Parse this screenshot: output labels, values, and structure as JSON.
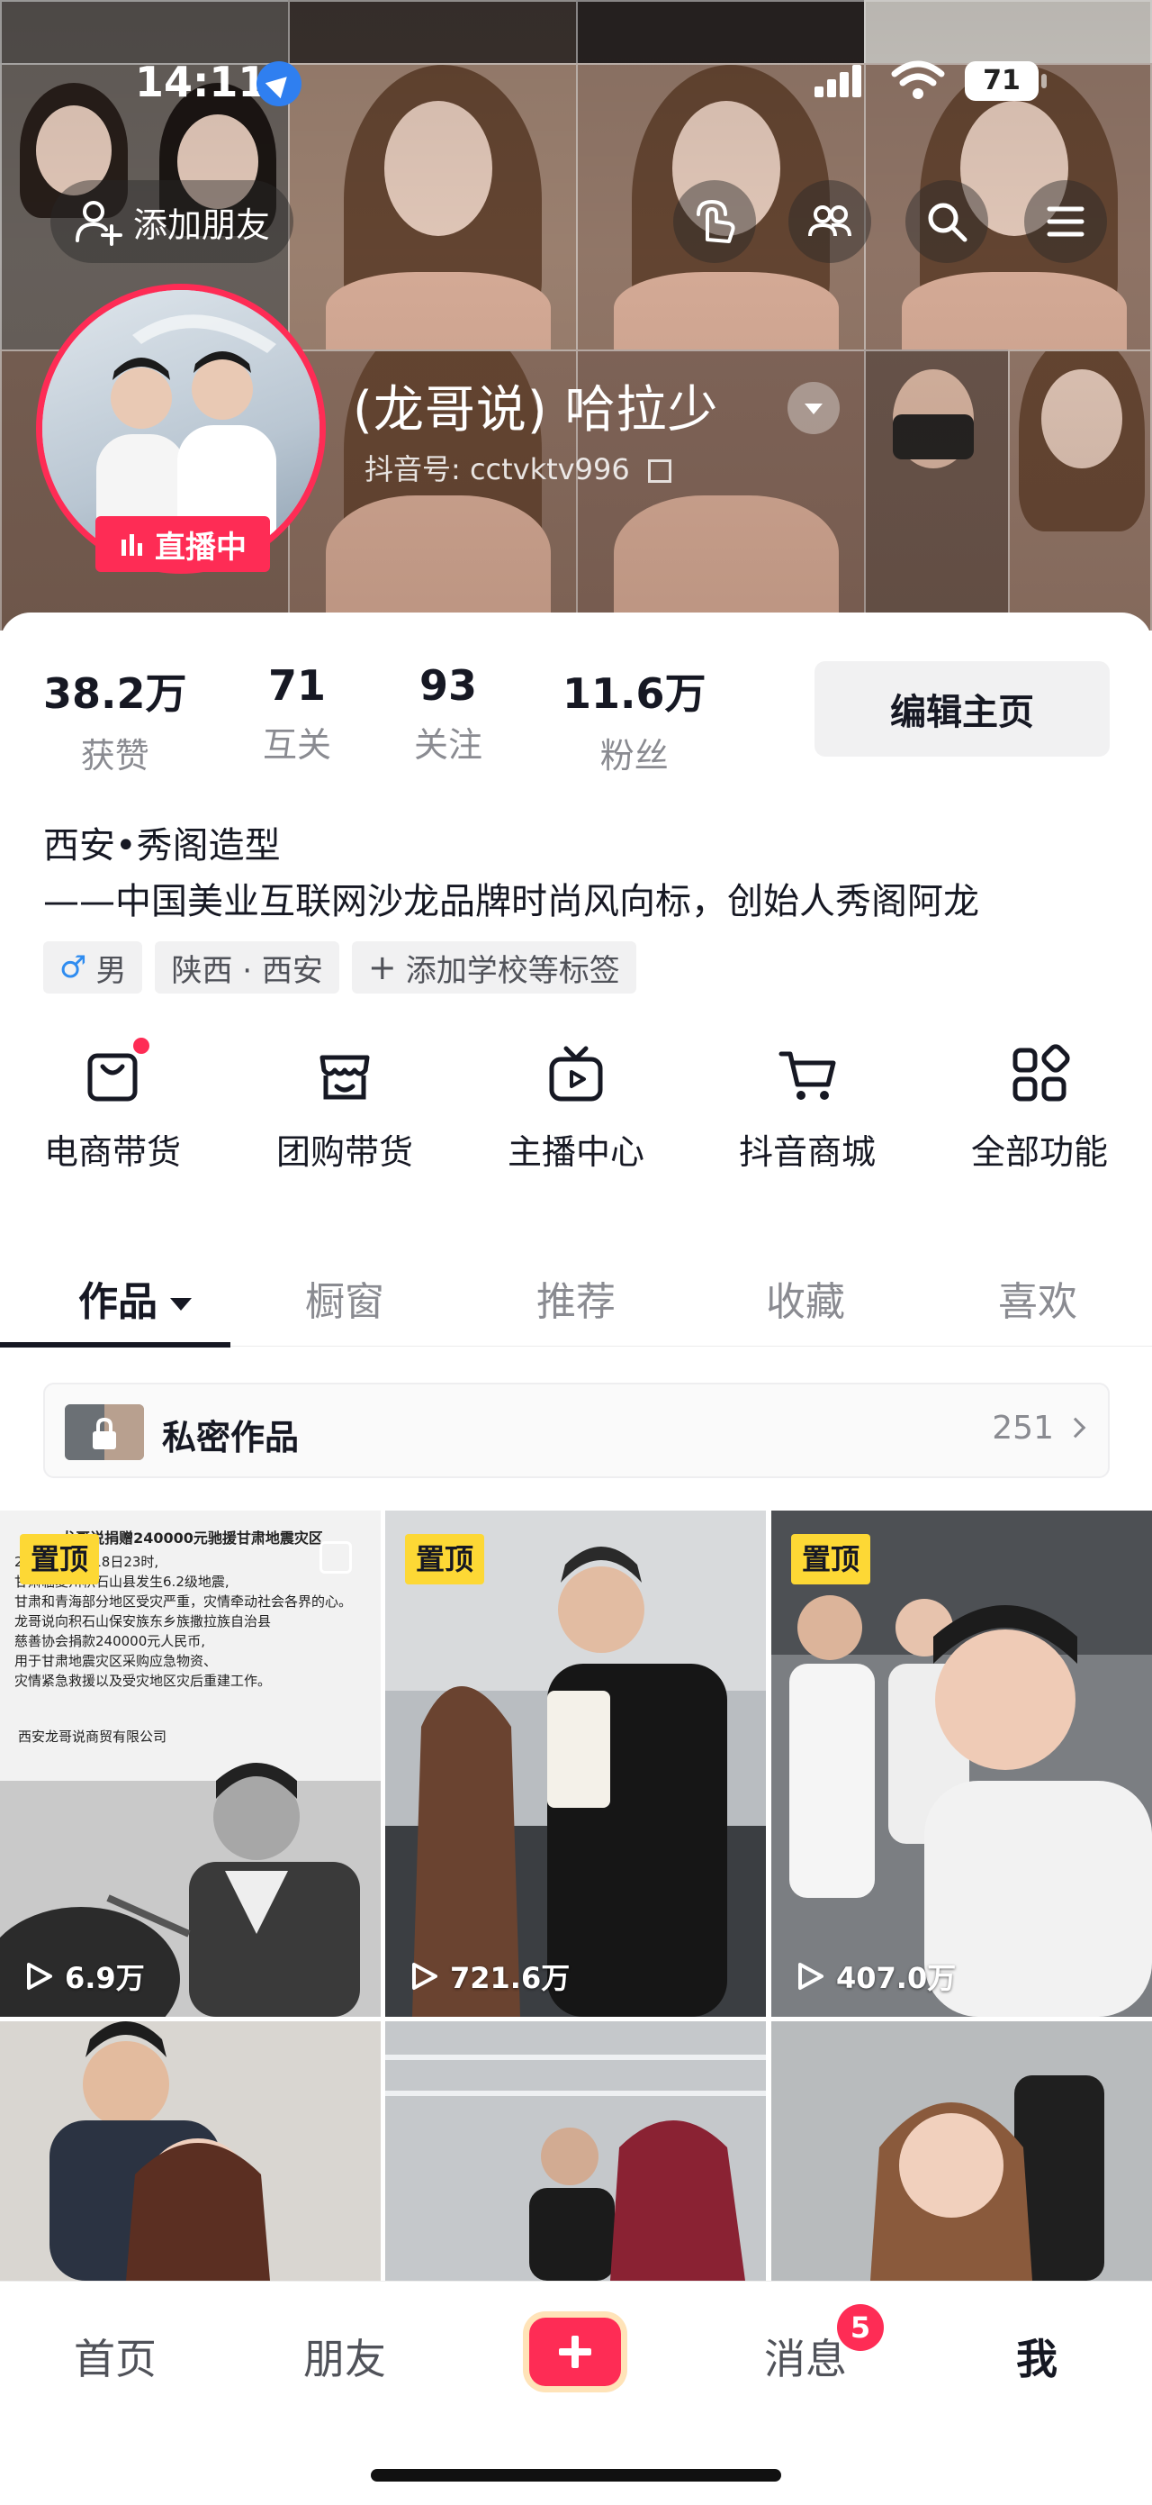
{
  "status_bar": {
    "time": "14:11",
    "battery": "71"
  },
  "header": {
    "add_friend_label": "添加朋友",
    "live_label": "直播中",
    "nickname": "(龙哥说) 哈拉少",
    "douyin_id": "抖音号: cctvktv996"
  },
  "stats": [
    {
      "value": "38.2万",
      "label": "获赞"
    },
    {
      "value": "71",
      "label": "互关"
    },
    {
      "value": "93",
      "label": "关注"
    },
    {
      "value": "11.6万",
      "label": "粉丝"
    }
  ],
  "edit_button": "编辑主页",
  "bio": {
    "line1": "西安•秀阁造型",
    "line2": "——中国美业互联网沙龙品牌时尚风向标，创始人秀阁阿龙"
  },
  "tags": [
    {
      "icon": "male-icon",
      "label": "男"
    },
    {
      "label": "陕西 · 西安"
    },
    {
      "icon": "plus-icon",
      "label": "添加学校等标签"
    }
  ],
  "features": [
    {
      "icon": "shopping-bag-icon",
      "label": "电商带货",
      "dot": true
    },
    {
      "icon": "store-icon",
      "label": "团购带货"
    },
    {
      "icon": "tv-icon",
      "label": "主播中心"
    },
    {
      "icon": "cart-icon",
      "label": "抖音商城"
    },
    {
      "icon": "grid-icon",
      "label": "全部功能"
    }
  ],
  "tabs": [
    "作品",
    "橱窗",
    "推荐",
    "收藏",
    "喜欢"
  ],
  "private_works": {
    "label": "私密作品",
    "count": "251"
  },
  "videos": [
    {
      "pinned": "置顶",
      "views": "6.9万"
    },
    {
      "pinned": "置顶",
      "views": "721.6万"
    },
    {
      "pinned": "置顶",
      "views": "407.0万"
    },
    {},
    {},
    {}
  ],
  "notice": {
    "lines": [
      "龙哥说捐赠240000元驰援甘肃地震灾区",
      "2023年12月18日23时,",
      "甘肃临夏州积石山县发生6.2级地震,",
      "甘肃和青海部分地区受灾严重，灾情牵动社会各界的心。",
      "龙哥说向积石山保安族东乡族撒拉族自治县",
      "慈善协会捐款240000元人民币,",
      "用于甘肃地震灾区采购应急物资、",
      "灾情紧急救援以及受灾地区灾后重建工作。"
    ],
    "org": "西安龙哥说商贸有限公司"
  },
  "bottom_nav": {
    "home": "首页",
    "friends": "朋友",
    "messages": "消息",
    "messages_badge": "5",
    "me": "我"
  }
}
